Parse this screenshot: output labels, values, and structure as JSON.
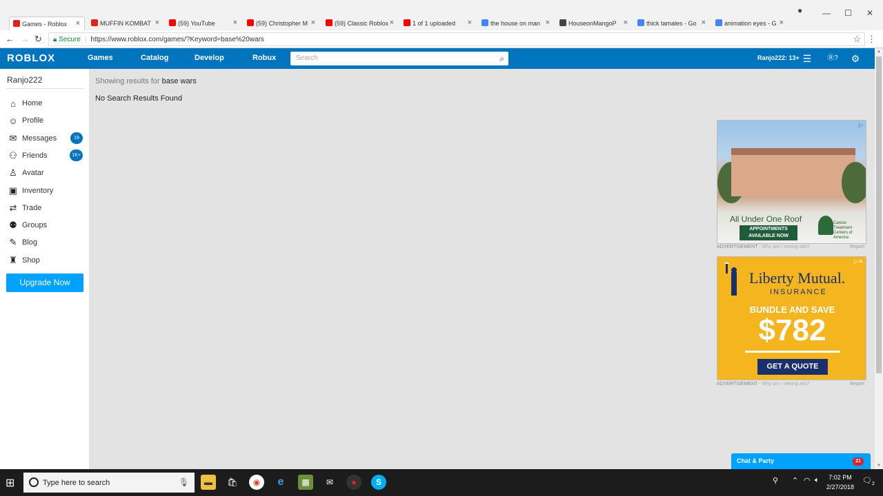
{
  "browser": {
    "tabs": [
      {
        "title": "Games - Roblox",
        "fav_color": "#e2231a",
        "active": true
      },
      {
        "title": "MUFFIN KOMBAT",
        "fav_color": "#e2231a"
      },
      {
        "title": "(59) YouTube",
        "fav_color": "#ff0000"
      },
      {
        "title": "(59) Christopher M",
        "fav_color": "#ff0000"
      },
      {
        "title": "(59) Classic Roblox",
        "fav_color": "#ff0000"
      },
      {
        "title": "1 of 1 uploaded",
        "fav_color": "#ff0000"
      },
      {
        "title": "the house on man",
        "fav_color": "#4285f4"
      },
      {
        "title": "HouseonMangoP",
        "fav_color": "#444444"
      },
      {
        "title": "thick tamales - Go",
        "fav_color": "#4285f4"
      },
      {
        "title": "animation eyes - G",
        "fav_color": "#4285f4"
      }
    ],
    "secure_label": "Secure",
    "url": "https://www.roblox.com/games/?Keyword=base%20wars"
  },
  "header": {
    "logo": "ROBLOX",
    "nav": [
      "Games",
      "Catalog",
      "Develop",
      "Robux"
    ],
    "search_placeholder": "Search",
    "user_age": "Ranjo222: 13+",
    "robux_count": "?"
  },
  "sidebar": {
    "username": "Ranjo222",
    "items": [
      {
        "label": "Home",
        "icon": "home-icon",
        "glyph": "⌂"
      },
      {
        "label": "Profile",
        "icon": "profile-icon",
        "glyph": "☺"
      },
      {
        "label": "Messages",
        "icon": "messages-icon",
        "glyph": "✉",
        "badge": "19"
      },
      {
        "label": "Friends",
        "icon": "friends-icon",
        "glyph": "⚇",
        "badge": "1K+"
      },
      {
        "label": "Avatar",
        "icon": "avatar-icon",
        "glyph": "♙"
      },
      {
        "label": "Inventory",
        "icon": "inventory-icon",
        "glyph": "▣"
      },
      {
        "label": "Trade",
        "icon": "trade-icon",
        "glyph": "⇄"
      },
      {
        "label": "Groups",
        "icon": "groups-icon",
        "glyph": "⚉"
      },
      {
        "label": "Blog",
        "icon": "blog-icon",
        "glyph": "✎"
      },
      {
        "label": "Shop",
        "icon": "shop-icon",
        "glyph": "♜"
      }
    ],
    "upgrade_label": "Upgrade Now"
  },
  "main": {
    "showing_prefix": "Showing results for",
    "keyword": "base wars",
    "no_results": "No Search Results Found"
  },
  "ads": {
    "ad1": {
      "headline": "All Under One Roof",
      "cta": "APPOINTMENTS AVAILABLE NOW",
      "brand": "Cancer Treatment Centers of America"
    },
    "ad2": {
      "brand": "Liberty Mutual.",
      "sub": "INSURANCE",
      "bundle": "BUNDLE AND SAVE",
      "price": "$782",
      "cta": "GET A QUOTE"
    },
    "label": "ADVERTISEMENT",
    "why": "- Why am I seeing ads?",
    "report": "Report"
  },
  "chat": {
    "label": "Chat & Party",
    "count": "21"
  },
  "taskbar": {
    "search_placeholder": "Type here to search",
    "time": "7:02 PM",
    "date": "2/27/2018",
    "notif_count": "2"
  }
}
